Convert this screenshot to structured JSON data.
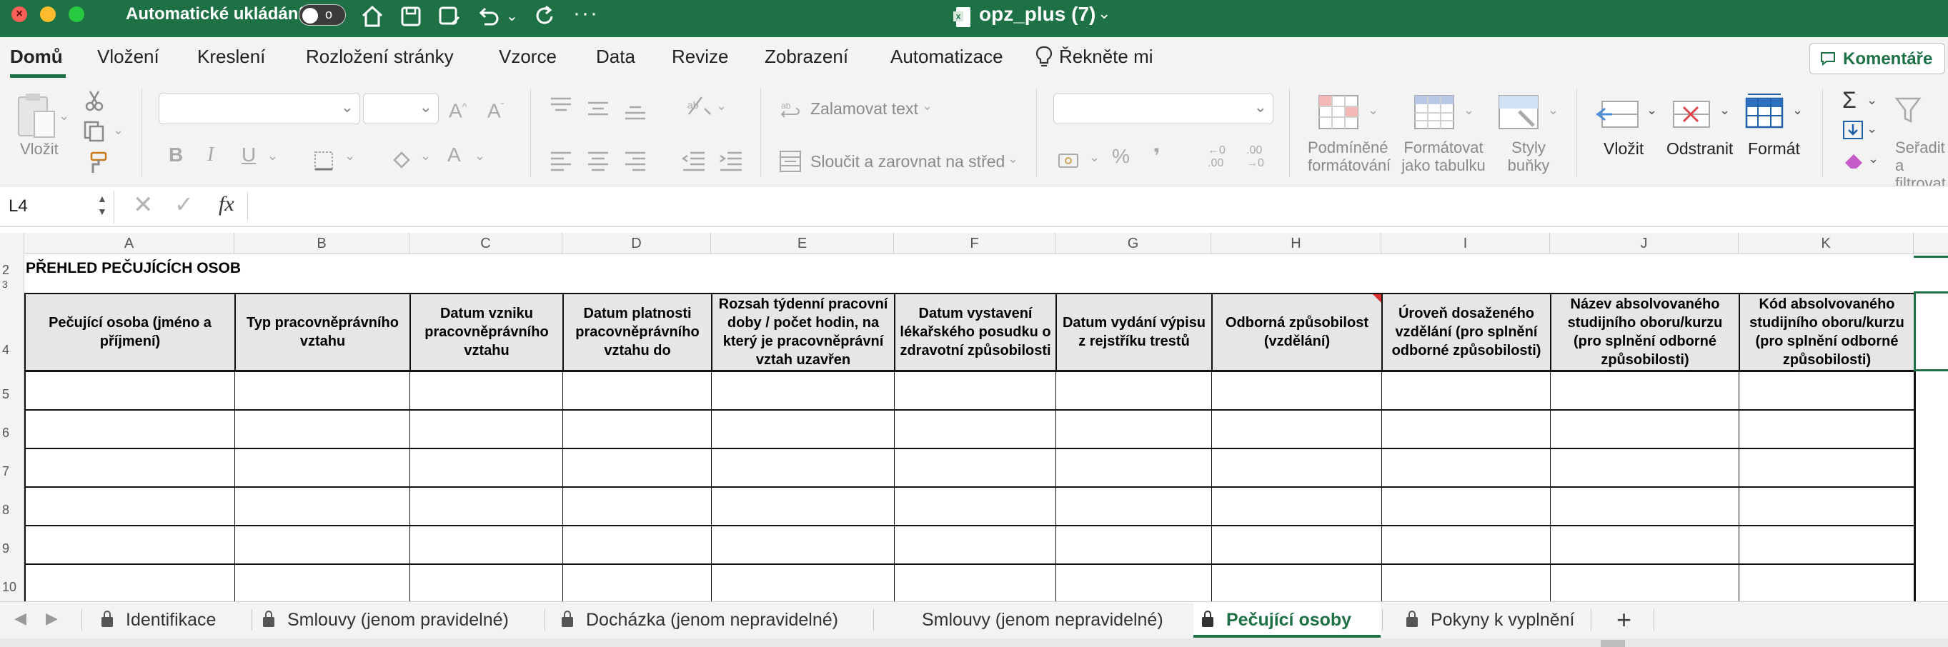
{
  "titlebar": {
    "autosave_label": "Automatické ukládání",
    "autosave_state": "o",
    "document_title": "opz_plus (7)",
    "background": "#1e7145"
  },
  "menu": {
    "items": [
      "Domů",
      "Vložení",
      "Kreslení",
      "Rozložení stránky",
      "Vzorce",
      "Data",
      "Revize",
      "Zobrazení",
      "Automatizace",
      "Řekněte mi"
    ],
    "active": "Domů",
    "comments_label": "Komentáře"
  },
  "ribbon": {
    "paste_label": "Vložit",
    "wrap_text_label": "Zalamovat text",
    "merge_center_label": "Sloučit a zarovnat na střed",
    "cond_format_label": "Podmíněné formátování",
    "format_table_label": "Formátovat jako tabulku",
    "cell_styles_label": "Styly buňky",
    "insert_label": "Vložit",
    "delete_label": "Odstranit",
    "format_label": "Formát",
    "sort_filter_label": "Seřadit a filtrovat"
  },
  "formula_bar": {
    "name_box": "L4",
    "fx": "fx",
    "value": ""
  },
  "sheet": {
    "columns": [
      "A",
      "B",
      "C",
      "D",
      "E",
      "F",
      "G",
      "H",
      "I",
      "J",
      "K"
    ],
    "rows": [
      "2",
      "3",
      "4",
      "5",
      "6",
      "7",
      "8",
      "9",
      "10"
    ],
    "title": "PŘEHLED PEČUJÍCÍCH OSOB",
    "headers": [
      "Pečující osoba (jméno a příjmení)",
      "Typ pracovněprávního vztahu",
      "Datum vzniku pracovněprávního vztahu",
      "Datum platnosti pracovněprávního vztahu do",
      "Rozsah týdenní pracovní doby / počet hodin, na který je pracovněprávní vztah uzavřen",
      "Datum vystavení lékařského posudku o zdravotní způsobilosti",
      "Datum vydání výpisu z rejstříku trestů",
      "Odborná způsobilost (vzdělání)",
      "Úroveň dosaženého vzdělání (pro splnění odborné způsobilosti)",
      "Název absolvovaného studijního oboru/kurzu (pro splnění odborné způsobilosti)",
      "Kód absolvovaného studijního oboru/kurzu (pro splnění odborné způsobilosti)"
    ]
  },
  "tabs": {
    "items": [
      "Identifikace",
      "Smlouvy (jenom pravidelné)",
      "Docházka (jenom nepravidelné)",
      "Smlouvy (jenom nepravidelné)",
      "Pečující osoby",
      "Pokyny k vyplnění"
    ],
    "active": "Pečující osoby",
    "add_label": "+"
  }
}
